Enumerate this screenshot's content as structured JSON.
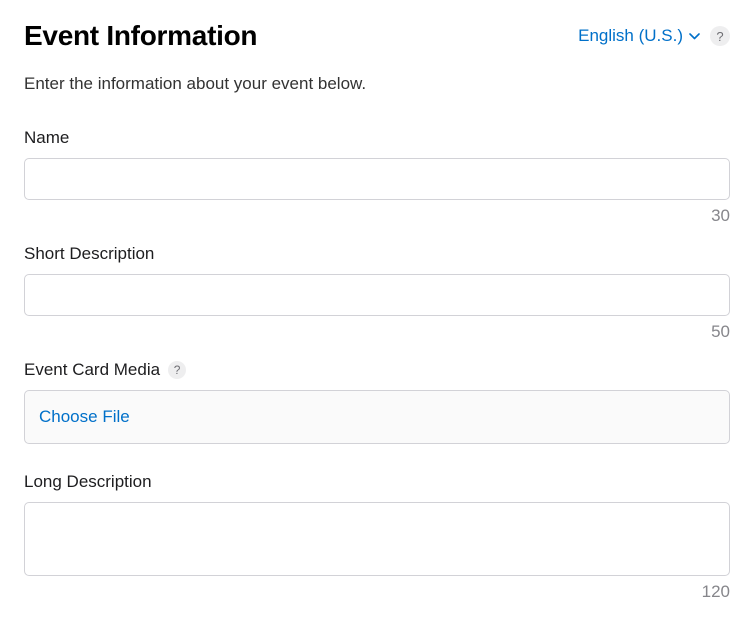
{
  "header": {
    "title": "Event Information",
    "language": "English (U.S.)",
    "help_symbol": "?"
  },
  "description": "Enter the information about your event below.",
  "fields": {
    "name": {
      "label": "Name",
      "value": "",
      "limit": "30"
    },
    "short_description": {
      "label": "Short Description",
      "value": "",
      "limit": "50"
    },
    "event_card_media": {
      "label": "Event Card Media",
      "help_symbol": "?",
      "choose_file_label": "Choose File"
    },
    "long_description": {
      "label": "Long Description",
      "value": "",
      "limit": "120"
    }
  }
}
